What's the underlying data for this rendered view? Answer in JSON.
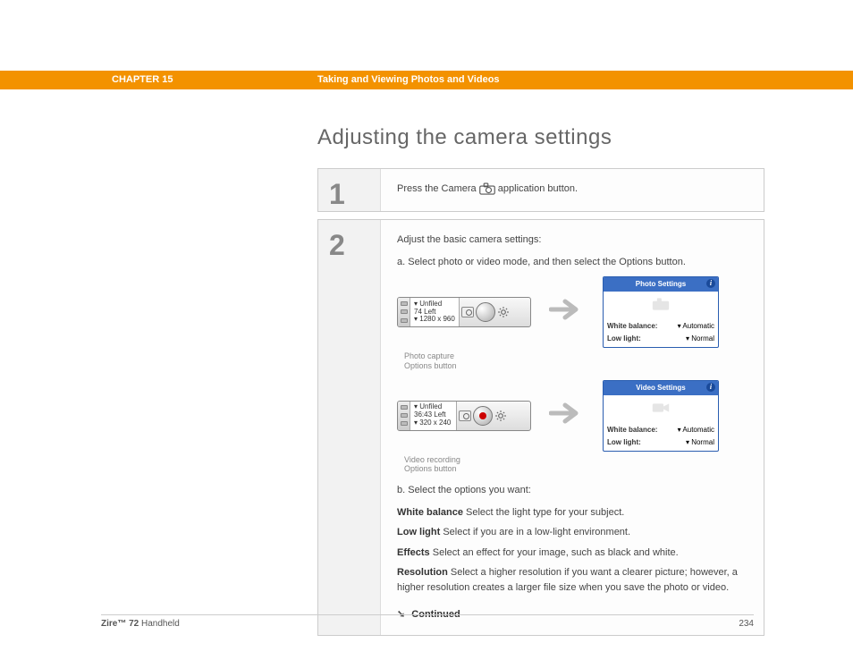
{
  "header": {
    "chapter": "CHAPTER 15",
    "title": "Taking and Viewing Photos and Videos"
  },
  "section_title": "Adjusting the camera settings",
  "steps": {
    "s1": {
      "num": "1",
      "text_before": "Press the Camera ",
      "text_after": " application button."
    },
    "s2": {
      "num": "2",
      "intro": "Adjust the basic camera settings:",
      "a": "a.  Select photo or video mode, and then select the Options button.",
      "photo_bar": {
        "line1": "▾ Unfiled",
        "line2": "74 Left",
        "line3": "▾ 1280 x 960"
      },
      "photo_caption": "Photo capture\nOptions button",
      "video_bar": {
        "line1": "▾ Unfiled",
        "line2": "36:43 Left",
        "line3": "▾ 320 x 240"
      },
      "video_caption": "Video recording\nOptions button",
      "photo_settings": {
        "title": "Photo Settings",
        "wb_label": "White balance:",
        "wb_val": "▾ Automatic",
        "ll_label": "Low light:",
        "ll_val": "▾ Normal"
      },
      "video_settings": {
        "title": "Video Settings",
        "wb_label": "White balance:",
        "wb_val": "▾ Automatic",
        "ll_label": "Low light:",
        "ll_val": "▾ Normal"
      },
      "b": "b.  Select the options you want:",
      "options": {
        "wb": {
          "term": "White balance",
          "desc": "   Select the light type for your subject."
        },
        "ll": {
          "term": "Low light",
          "desc": "   Select if you are in a low-light environment."
        },
        "ef": {
          "term": "Effects",
          "desc": "   Select an effect for your image, such as black and white."
        },
        "res": {
          "term": "Resolution",
          "desc": "   Select a higher resolution if you want a clearer picture; however, a higher resolution creates a larger file size when you save the photo or video."
        }
      },
      "continued": "Continued"
    }
  },
  "footer": {
    "product_bold": "Zire™ 72",
    "product_rest": " Handheld",
    "page": "234"
  }
}
